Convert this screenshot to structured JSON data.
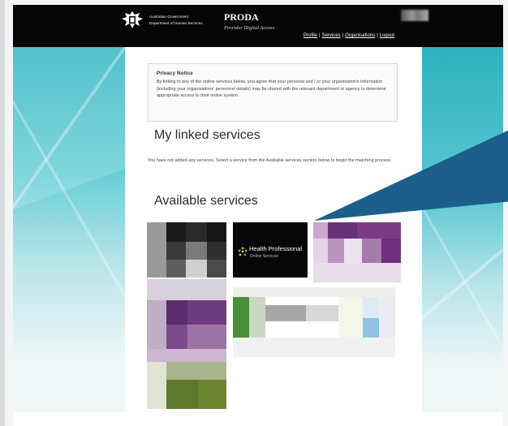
{
  "header": {
    "gov_line1": "Australian Government",
    "gov_line2": "Department of Human Services",
    "app_title": "PRODA",
    "app_subtitle": "Provider Digital Access",
    "nav": [
      {
        "label": "Profile"
      },
      {
        "label": "Services"
      },
      {
        "label": "Organisations"
      },
      {
        "label": "Logout"
      }
    ],
    "separator": "|"
  },
  "privacy": {
    "title": "Privacy Notice",
    "text": "By linking to any of the online services below, you agree that your personal and / or your organisation's information (including your organisations' personnel details) may be shared with the relevant department or agency to determine appropriate access to their online system."
  },
  "linked": {
    "heading": "My linked services",
    "text": "You have not added any services. Select a service from the Available services section below to begin the matching process."
  },
  "available": {
    "heading": "Available services",
    "hpos": {
      "line1": "Health Professional",
      "line2": "Online Services"
    }
  },
  "icons": {
    "crest": "commonwealth-crest-icon",
    "hpos_logo": "hpos-dots-icon"
  },
  "colors": {
    "header_bg": "#050505",
    "accent_teal": "#35b6c2",
    "callout": "#1c5f8a",
    "purple": "#6a3b7d",
    "green": "#5d7a2f"
  }
}
